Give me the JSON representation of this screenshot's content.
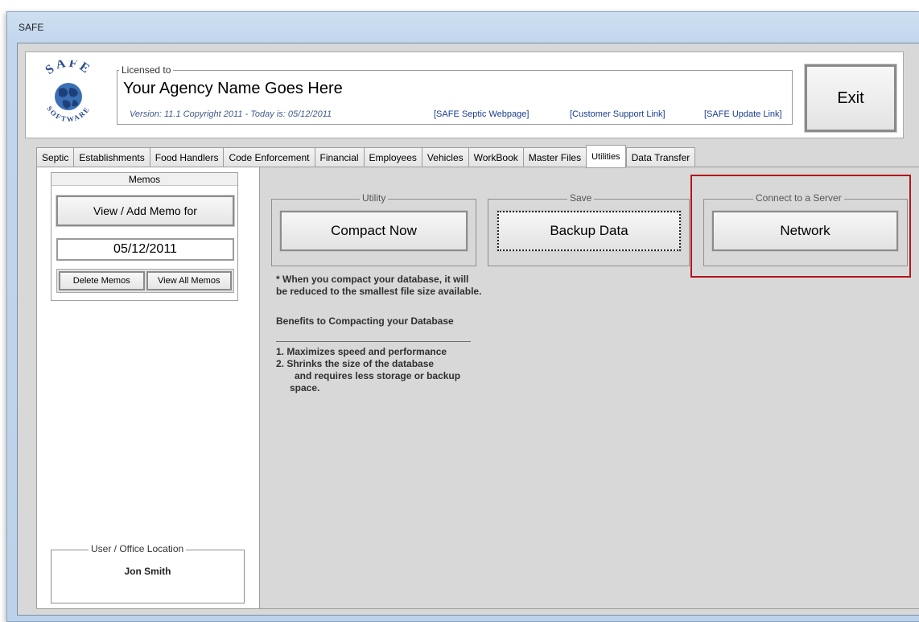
{
  "window": {
    "title": "SAFE"
  },
  "header": {
    "logo_text_top": "SAFE",
    "logo_text_bottom": "SOFTWARE",
    "licensed_label": "Licensed to",
    "agency_name": "Your Agency Name Goes Here",
    "version_line": "Version: 11.1  Copyright 2011 - Today is: 05/12/2011",
    "links": [
      "[SAFE Septic Webpage]",
      "[Customer Support Link]",
      "[SAFE Update Link]"
    ],
    "exit_label": "Exit"
  },
  "tabs": [
    "Septic",
    "Establishments",
    "Food Handlers",
    "Code Enforcement",
    "Financial",
    "Employees",
    "Vehicles",
    "WorkBook",
    "Master Files",
    "Utilities",
    "Data Transfer"
  ],
  "active_tab": "Utilities",
  "memos": {
    "title": "Memos",
    "view_add_label": "View / Add Memo for",
    "date": "05/12/2011",
    "delete_label": "Delete Memos",
    "view_all_label": "View All Memos"
  },
  "user": {
    "label": "User / Office Location",
    "name": "Jon Smith"
  },
  "utility_group": {
    "label": "Utility",
    "button": "Compact Now"
  },
  "save_group": {
    "label": "Save",
    "button": "Backup Data"
  },
  "server_group": {
    "label": "Connect to a Server",
    "button": "Network"
  },
  "info": {
    "note_line1": "* When you compact your database, it will",
    "note_line2": "be reduced to the smallest file size available.",
    "benefits_title": "Benefits to Compacting your Database",
    "item1": "1.  Maximizes speed and performance",
    "item2": "2.  Shrinks the size of the database",
    "item2_cont1": "and requires less storage or backup",
    "item2_cont2": "space."
  },
  "colors": {
    "highlight": "#b3161b",
    "link": "#1a3d8f",
    "panel_bg": "#d8d8d8"
  }
}
